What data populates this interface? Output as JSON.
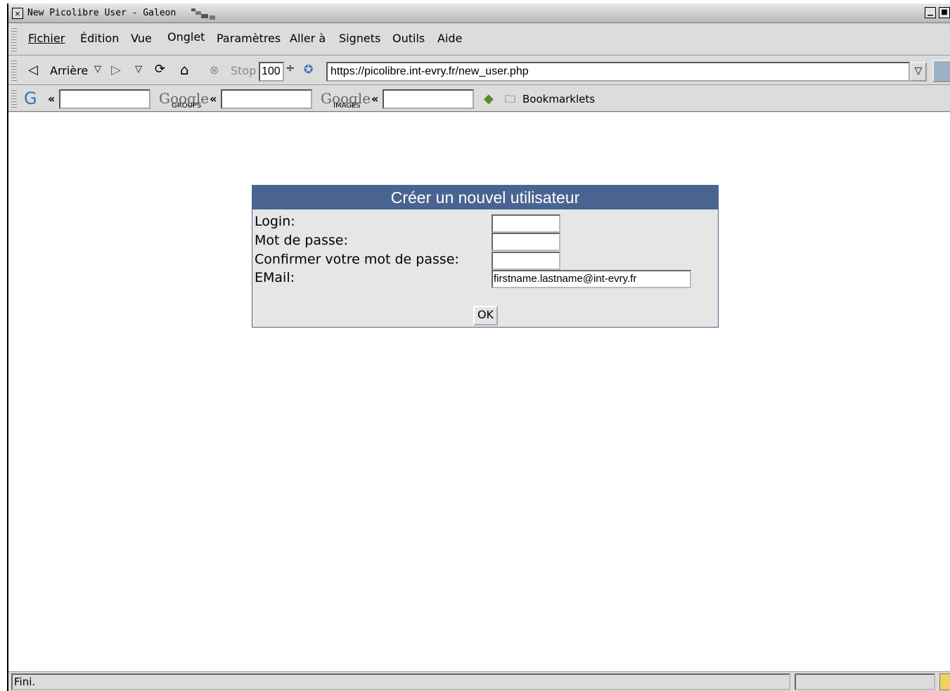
{
  "window": {
    "title": "New Picolibre User - Galeon"
  },
  "menubar": {
    "items": [
      "Fichier",
      "Édition",
      "Vue",
      "Onglet",
      "Paramètres",
      "Aller à",
      "Signets",
      "Outils",
      "Aide"
    ]
  },
  "navbar": {
    "back_label": "Arrière",
    "stop_label": "Stop",
    "zoom_value": "100",
    "url": "https://picolibre.int-evry.fr/new_user.php"
  },
  "searchbar": {
    "google_groups_text": "GROUPS",
    "google_images_text": "IMAGES",
    "bookmarklets_label": "Bookmarklets"
  },
  "form": {
    "title": "Créer un nouvel utilisateur",
    "login_label": "Login:",
    "login_value": "",
    "password_label": "Mot de passe:",
    "password_value": "",
    "confirm_label": "Confirmer votre mot de passe:",
    "confirm_value": "",
    "email_label": "EMail:",
    "email_value": "firstname.lastname@int-evry.fr",
    "ok_label": "OK"
  },
  "status": {
    "text": "Fini."
  },
  "colors": {
    "form_header": "#4a6491",
    "form_background": "#e6e6e6",
    "chrome": "#dcdcdc"
  }
}
